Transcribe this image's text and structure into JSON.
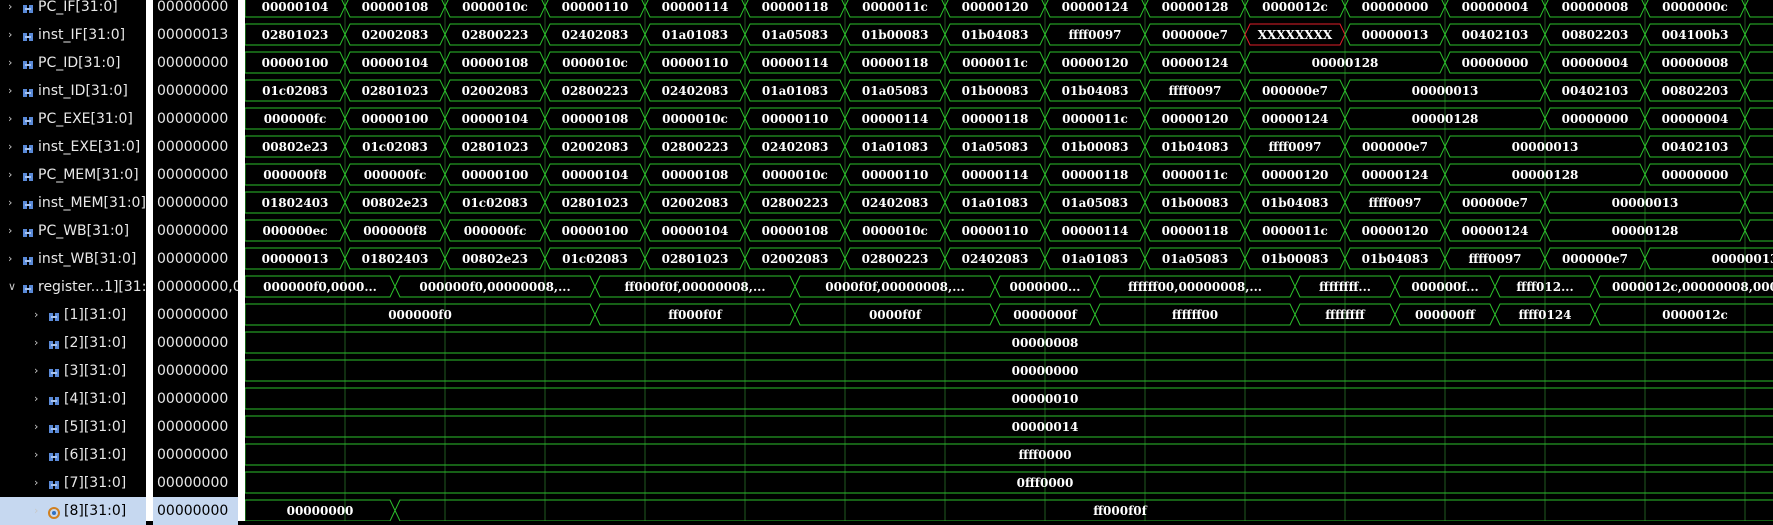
{
  "signals": [
    {
      "name": "PC_IF[31:0]",
      "value": "00000000",
      "level": 0,
      "expandable": true,
      "icon": "bus-icon",
      "segments": [
        {
          "v": "00000104"
        },
        {
          "v": "00000108"
        },
        {
          "v": "0000010c"
        },
        {
          "v": "00000110"
        },
        {
          "v": "00000114"
        },
        {
          "v": "00000118"
        },
        {
          "v": "0000011c"
        },
        {
          "v": "00000120"
        },
        {
          "v": "00000124"
        },
        {
          "v": "00000128"
        },
        {
          "v": "0000012c"
        },
        {
          "v": "00000000"
        },
        {
          "v": "00000004"
        },
        {
          "v": "00000008"
        },
        {
          "v": "0000000c"
        },
        {
          "v": ""
        }
      ]
    },
    {
      "name": "inst_IF[31:0]",
      "value": "00000013",
      "level": 0,
      "expandable": true,
      "icon": "bus-icon",
      "segments": [
        {
          "v": "02801023"
        },
        {
          "v": "02002083"
        },
        {
          "v": "02800223"
        },
        {
          "v": "02402083"
        },
        {
          "v": "01a01083"
        },
        {
          "v": "01a05083"
        },
        {
          "v": "01b00083"
        },
        {
          "v": "01b04083"
        },
        {
          "v": "ffff0097"
        },
        {
          "v": "000000e7"
        },
        {
          "v": "XXXXXXXX",
          "x": true
        },
        {
          "v": "00000013"
        },
        {
          "v": "00402103"
        },
        {
          "v": "00802203"
        },
        {
          "v": "004100b3"
        },
        {
          "v": ""
        }
      ]
    },
    {
      "name": "PC_ID[31:0]",
      "value": "00000000",
      "level": 0,
      "expandable": true,
      "icon": "bus-icon",
      "segments": [
        {
          "v": "00000100"
        },
        {
          "v": "00000104"
        },
        {
          "v": "00000108"
        },
        {
          "v": "0000010c"
        },
        {
          "v": "00000110"
        },
        {
          "v": "00000114"
        },
        {
          "v": "00000118"
        },
        {
          "v": "0000011c"
        },
        {
          "v": "00000120"
        },
        {
          "v": "00000124"
        },
        {
          "v": "00000128",
          "span": 2
        },
        {
          "v": "00000000"
        },
        {
          "v": "00000004"
        },
        {
          "v": "00000008"
        },
        {
          "v": ""
        }
      ]
    },
    {
      "name": "inst_ID[31:0]",
      "value": "00000000",
      "level": 0,
      "expandable": true,
      "icon": "bus-icon",
      "segments": [
        {
          "v": "01c02083"
        },
        {
          "v": "02801023"
        },
        {
          "v": "02002083"
        },
        {
          "v": "02800223"
        },
        {
          "v": "02402083"
        },
        {
          "v": "01a01083"
        },
        {
          "v": "01a05083"
        },
        {
          "v": "01b00083"
        },
        {
          "v": "01b04083"
        },
        {
          "v": "ffff0097"
        },
        {
          "v": "000000e7"
        },
        {
          "v": "00000013",
          "span": 2
        },
        {
          "v": "00402103"
        },
        {
          "v": "00802203"
        },
        {
          "v": ""
        }
      ]
    },
    {
      "name": "PC_EXE[31:0]",
      "value": "00000000",
      "level": 0,
      "expandable": true,
      "icon": "bus-icon",
      "segments": [
        {
          "v": "000000fc"
        },
        {
          "v": "00000100"
        },
        {
          "v": "00000104"
        },
        {
          "v": "00000108"
        },
        {
          "v": "0000010c"
        },
        {
          "v": "00000110"
        },
        {
          "v": "00000114"
        },
        {
          "v": "00000118"
        },
        {
          "v": "0000011c"
        },
        {
          "v": "00000120"
        },
        {
          "v": "00000124"
        },
        {
          "v": "00000128",
          "span": 2
        },
        {
          "v": "00000000"
        },
        {
          "v": "00000004"
        },
        {
          "v": ""
        }
      ]
    },
    {
      "name": "inst_EXE[31:0]",
      "value": "00000000",
      "level": 0,
      "expandable": true,
      "icon": "bus-icon",
      "segments": [
        {
          "v": "00802e23"
        },
        {
          "v": "01c02083"
        },
        {
          "v": "02801023"
        },
        {
          "v": "02002083"
        },
        {
          "v": "02800223"
        },
        {
          "v": "02402083"
        },
        {
          "v": "01a01083"
        },
        {
          "v": "01a05083"
        },
        {
          "v": "01b00083"
        },
        {
          "v": "01b04083"
        },
        {
          "v": "ffff0097"
        },
        {
          "v": "000000e7"
        },
        {
          "v": "00000013",
          "span": 2
        },
        {
          "v": "00402103"
        },
        {
          "v": ""
        }
      ]
    },
    {
      "name": "PC_MEM[31:0]",
      "value": "00000000",
      "level": 0,
      "expandable": true,
      "icon": "bus-icon",
      "segments": [
        {
          "v": "000000f8"
        },
        {
          "v": "000000fc"
        },
        {
          "v": "00000100"
        },
        {
          "v": "00000104"
        },
        {
          "v": "00000108"
        },
        {
          "v": "0000010c"
        },
        {
          "v": "00000110"
        },
        {
          "v": "00000114"
        },
        {
          "v": "00000118"
        },
        {
          "v": "0000011c"
        },
        {
          "v": "00000120"
        },
        {
          "v": "00000124"
        },
        {
          "v": "00000128",
          "span": 2
        },
        {
          "v": "00000000"
        },
        {
          "v": ""
        }
      ]
    },
    {
      "name": "inst_MEM[31:0]",
      "value": "00000000",
      "level": 0,
      "expandable": true,
      "icon": "bus-icon",
      "segments": [
        {
          "v": "01802403"
        },
        {
          "v": "00802e23"
        },
        {
          "v": "01c02083"
        },
        {
          "v": "02801023"
        },
        {
          "v": "02002083"
        },
        {
          "v": "02800223"
        },
        {
          "v": "02402083"
        },
        {
          "v": "01a01083"
        },
        {
          "v": "01a05083"
        },
        {
          "v": "01b00083"
        },
        {
          "v": "01b04083"
        },
        {
          "v": "ffff0097"
        },
        {
          "v": "000000e7"
        },
        {
          "v": "00000013",
          "span": 2
        },
        {
          "v": ""
        }
      ]
    },
    {
      "name": "PC_WB[31:0]",
      "value": "00000000",
      "level": 0,
      "expandable": true,
      "icon": "bus-icon",
      "segments": [
        {
          "v": "000000ec"
        },
        {
          "v": "000000f8"
        },
        {
          "v": "000000fc"
        },
        {
          "v": "00000100"
        },
        {
          "v": "00000104"
        },
        {
          "v": "00000108"
        },
        {
          "v": "0000010c"
        },
        {
          "v": "00000110"
        },
        {
          "v": "00000114"
        },
        {
          "v": "00000118"
        },
        {
          "v": "0000011c"
        },
        {
          "v": "00000120"
        },
        {
          "v": "00000124"
        },
        {
          "v": "00000128",
          "span": 2
        },
        {
          "v": ""
        }
      ]
    },
    {
      "name": "inst_WB[31:0]",
      "value": "00000000",
      "level": 0,
      "expandable": true,
      "icon": "bus-icon",
      "segments": [
        {
          "v": "00000013"
        },
        {
          "v": "01802403"
        },
        {
          "v": "00802e23"
        },
        {
          "v": "01c02083"
        },
        {
          "v": "02801023"
        },
        {
          "v": "02002083"
        },
        {
          "v": "02800223"
        },
        {
          "v": "02402083"
        },
        {
          "v": "01a01083"
        },
        {
          "v": "01a05083"
        },
        {
          "v": "01b00083"
        },
        {
          "v": "01b04083"
        },
        {
          "v": "ffff0097"
        },
        {
          "v": "000000e7"
        },
        {
          "v": "00000013",
          "span": 2
        }
      ]
    },
    {
      "name": "register...1][31:0]",
      "value": "00000000,00",
      "level": 0,
      "expanded": true,
      "icon": "bus-icon",
      "segments": [
        {
          "v": "000000f0,0000...",
          "span": 1.5
        },
        {
          "v": "000000f0,00000008,...",
          "span": 2
        },
        {
          "v": "ff000f0f,00000008,...",
          "span": 2
        },
        {
          "v": "0000f0f,00000008,...",
          "span": 2
        },
        {
          "v": "0000000...",
          "span": 1
        },
        {
          "v": "ffffff00,00000008,...",
          "span": 2
        },
        {
          "v": "ffffffff...",
          "span": 1
        },
        {
          "v": "000000f...",
          "span": 1
        },
        {
          "v": "ffff012...",
          "span": 1
        },
        {
          "v": "0000012c,00000008,000",
          "span": 2
        }
      ]
    },
    {
      "name": "[1][31:0]",
      "value": "00000000",
      "level": 1,
      "expandable": true,
      "icon": "bus-icon",
      "segments": [
        {
          "v": "000000f0",
          "span": 3.5
        },
        {
          "v": "ff000f0f",
          "span": 2
        },
        {
          "v": "0000f0f",
          "span": 2
        },
        {
          "v": "0000000f",
          "span": 1
        },
        {
          "v": "ffffff00",
          "span": 2
        },
        {
          "v": "ffffffff",
          "span": 1
        },
        {
          "v": "000000ff",
          "span": 1
        },
        {
          "v": "ffff0124",
          "span": 1
        },
        {
          "v": "0000012c",
          "span": 2
        }
      ]
    },
    {
      "name": "[2][31:0]",
      "value": "00000000",
      "level": 1,
      "expandable": true,
      "icon": "bus-icon",
      "segments": [
        {
          "v": "00000008",
          "span": 16
        }
      ]
    },
    {
      "name": "[3][31:0]",
      "value": "00000000",
      "level": 1,
      "expandable": true,
      "icon": "bus-icon",
      "segments": [
        {
          "v": "00000000",
          "span": 16
        }
      ]
    },
    {
      "name": "[4][31:0]",
      "value": "00000000",
      "level": 1,
      "expandable": true,
      "icon": "bus-icon",
      "segments": [
        {
          "v": "00000010",
          "span": 16
        }
      ]
    },
    {
      "name": "[5][31:0]",
      "value": "00000000",
      "level": 1,
      "expandable": true,
      "icon": "bus-icon",
      "segments": [
        {
          "v": "00000014",
          "span": 16
        }
      ]
    },
    {
      "name": "[6][31:0]",
      "value": "00000000",
      "level": 1,
      "expandable": true,
      "icon": "bus-icon",
      "segments": [
        {
          "v": "ffff0000",
          "span": 16
        }
      ]
    },
    {
      "name": "[7][31:0]",
      "value": "00000000",
      "level": 1,
      "expandable": true,
      "icon": "bus-icon",
      "segments": [
        {
          "v": "0fff0000",
          "span": 16
        }
      ]
    },
    {
      "name": "[8][31:0]",
      "value": "00000000",
      "level": 1,
      "expandable": true,
      "selected": true,
      "icon": "bus-icon-active",
      "segments": [
        {
          "v": "00000000",
          "span": 1.5
        },
        {
          "v": "ff000f0f",
          "span": 14.5
        }
      ]
    }
  ],
  "colors": {
    "background": "#000000",
    "wave": "#2bc02b",
    "wave_undefined": "#e0202a",
    "grid": "#1f5a1f",
    "text": "#ffffff",
    "selected_row": "#c6d8f0"
  }
}
